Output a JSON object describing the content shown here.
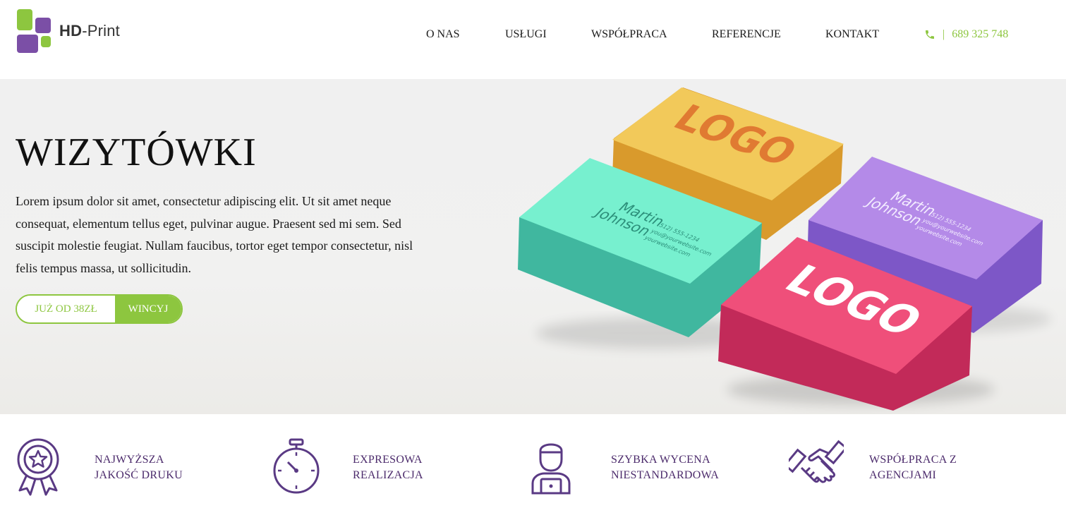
{
  "brand": {
    "logo_bold": "HD",
    "logo_rest": "-Print",
    "primary_color": "#8dc63f",
    "secondary_color": "#7b4fa6"
  },
  "nav": {
    "items": [
      {
        "label": "O NAS"
      },
      {
        "label": "USŁUGI"
      },
      {
        "label": "WSPÓŁPRACA"
      },
      {
        "label": "REFERENCJE"
      },
      {
        "label": "KONTAKT"
      }
    ],
    "phone_icon": "phone-icon",
    "phone_separator": "|",
    "phone": "689 325 748"
  },
  "hero": {
    "title": "WIZYTÓWKI",
    "text": "Lorem ipsum dolor sit amet, consectetur adipiscing elit. Ut sit amet neque consequat, elementum tellus eget, pulvinar augue. Praesent sed mi sem. Sed suscipit molestie feugiat. Nullam faucibus, tortor eget tempor consectetur, nisl felis tempus massa, ut sollicitudin.",
    "price_label": "JUŻ OD 38ZŁ",
    "button_label": "WINCYJ",
    "cards": {
      "logo_text": "LOGO",
      "name_line1": "Martin",
      "name_line2": "Johnson",
      "phone": "(512) 555-1234",
      "email": "you@yourwebsite.com",
      "website": "yourwebsite.com"
    }
  },
  "features": [
    {
      "icon": "award-icon",
      "line1": "NAJWYŻSZA",
      "line2": "JAKOŚĆ DRUKU"
    },
    {
      "icon": "stopwatch-icon",
      "line1": "EXPRESOWA",
      "line2": "REALIZACJA"
    },
    {
      "icon": "person-laptop-icon",
      "line1": "SZYBKA WYCENA",
      "line2": "NIESTANDARDOWA"
    },
    {
      "icon": "handshake-icon",
      "line1": "WSPÓŁPRACA Z",
      "line2": "AGENCJAMI"
    }
  ]
}
